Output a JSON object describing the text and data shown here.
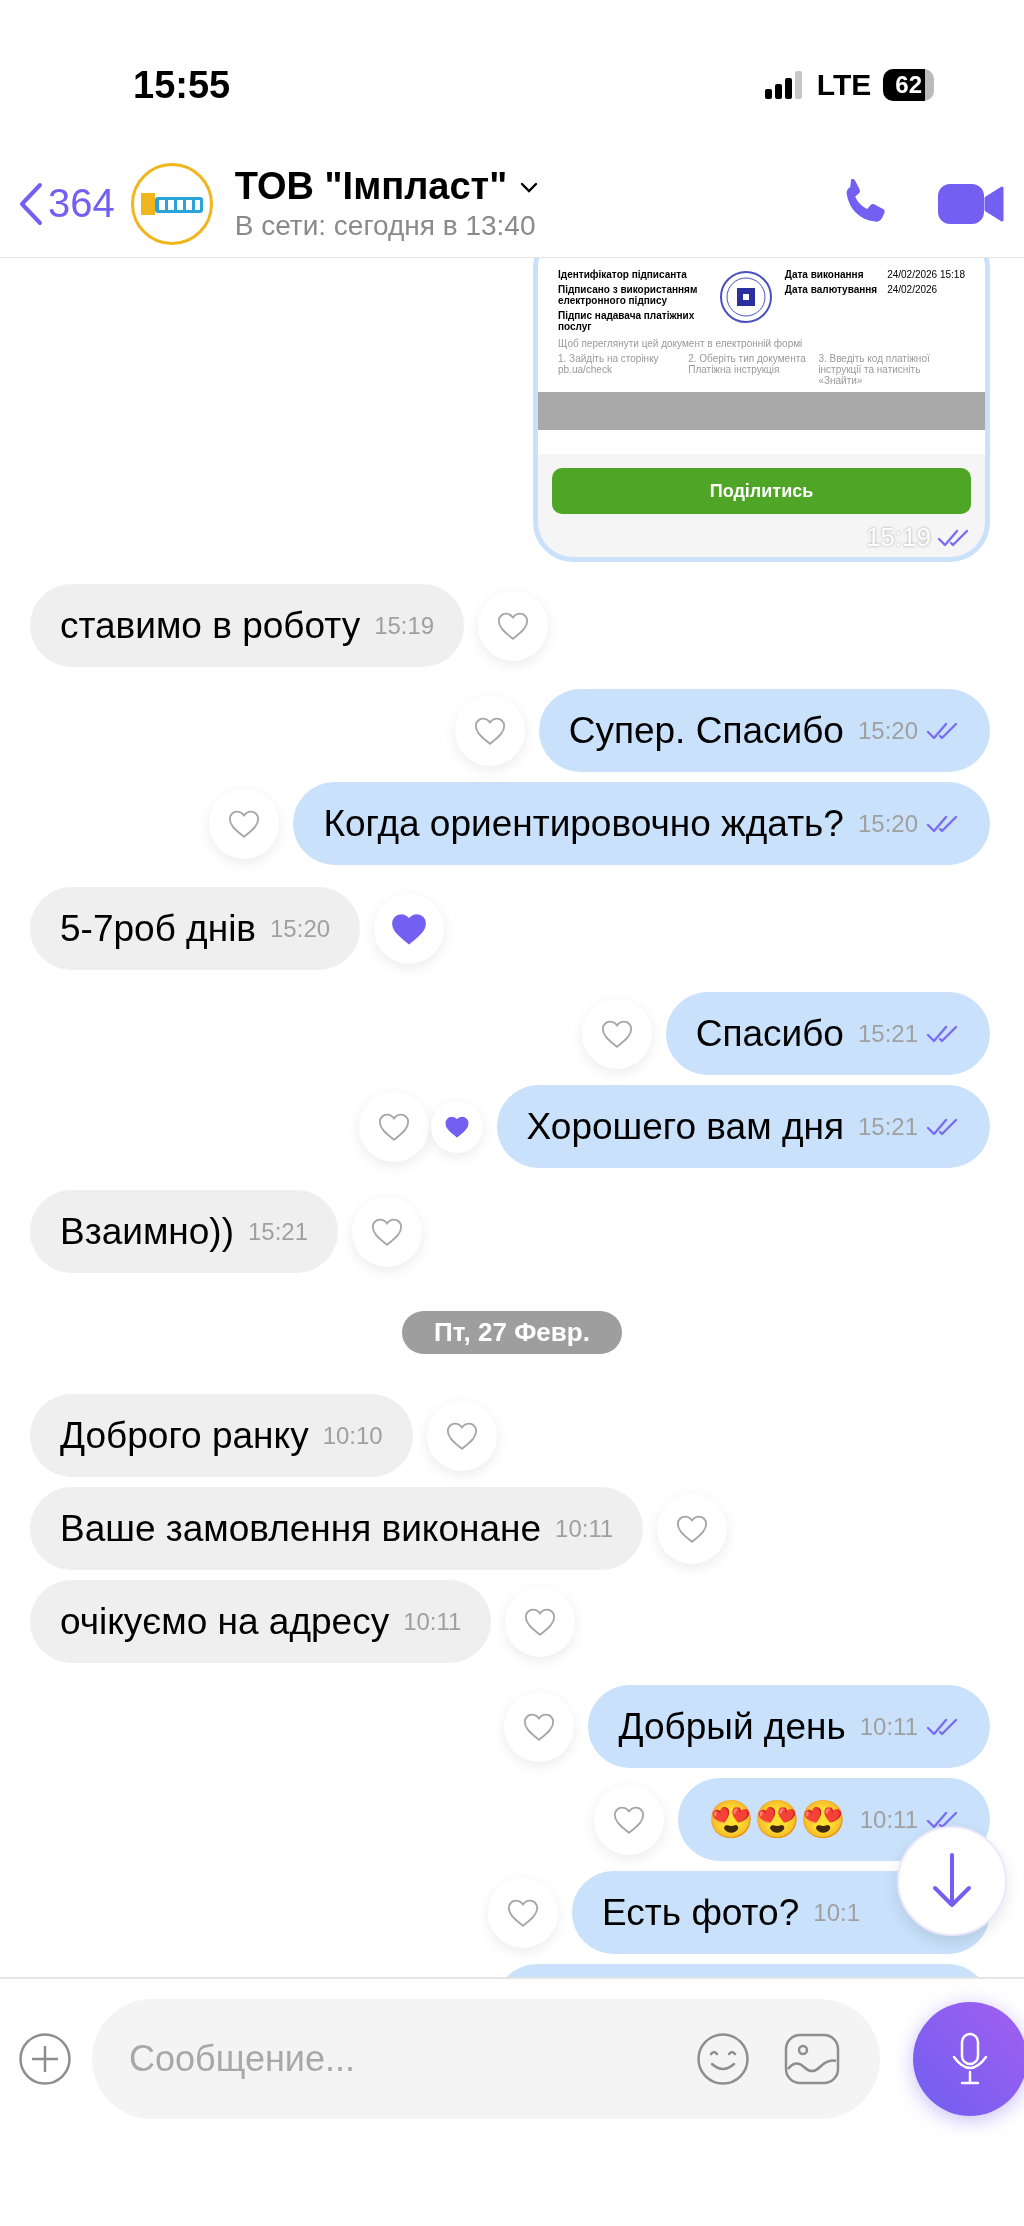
{
  "status_bar": {
    "time": "15:55",
    "network": "LTE",
    "battery": "62"
  },
  "header": {
    "back_count": "364",
    "title": "ТОВ \"Імпласт\"",
    "subtitle": "В сети: сегодня в 13:40"
  },
  "messages": [
    {
      "kind": "document",
      "outgoing": true,
      "time": "15:19",
      "ticks": true,
      "document": {
        "left_rows": [
          "Ідентифікатор підписанта",
          "Підписано з використанням електронного підпису",
          "Підпис надавача платіжних послуг"
        ],
        "right_rows": [
          {
            "label": "Дата виконання",
            "value": "24/02/2026 15:18"
          },
          {
            "label": "Дата валютування",
            "value": "24/02/2026"
          }
        ],
        "hint": "Щоб переглянути цей документ в електронній формі",
        "steps": [
          "1. Зайдіть на сторінку pb.ua/check",
          "2. Оберіть тип документа Платіжна інструкція",
          "3. Введіть код платіжної інструкції та натисніть «Знайти»"
        ]
      },
      "button": "Поділитись"
    },
    {
      "kind": "text",
      "outgoing": false,
      "text": "ставимо в роботу",
      "time": "15:19",
      "liked": false,
      "liked_by_other": false
    },
    {
      "kind": "text",
      "outgoing": true,
      "text": "Супер. Спасибо",
      "time": "15:20",
      "ticks": true,
      "liked": false,
      "liked_by_other": false
    },
    {
      "kind": "text",
      "outgoing": true,
      "text": "Когда ориентировочно ждать?",
      "time": "15:20",
      "ticks": true,
      "liked": false,
      "liked_by_other": false
    },
    {
      "kind": "text",
      "outgoing": false,
      "text": "5-7роб днів",
      "time": "15:20",
      "liked": true,
      "liked_by_other": false
    },
    {
      "kind": "text",
      "outgoing": true,
      "text": "Спасибо",
      "time": "15:21",
      "ticks": true,
      "liked": false,
      "liked_by_other": false
    },
    {
      "kind": "text",
      "outgoing": true,
      "text": "Хорошего вам дня",
      "time": "15:21",
      "ticks": true,
      "liked": false,
      "liked_by_other": true
    },
    {
      "kind": "text",
      "outgoing": false,
      "text": "Взаимно))",
      "time": "15:21",
      "liked": false,
      "liked_by_other": false
    },
    {
      "kind": "date",
      "text": "Пт, 27 Февр."
    },
    {
      "kind": "text",
      "outgoing": false,
      "text": "Доброго ранку",
      "time": "10:10",
      "liked": false,
      "liked_by_other": false
    },
    {
      "kind": "text",
      "outgoing": false,
      "text": "Ваше замовлення виконане",
      "time": "10:11",
      "liked": false,
      "liked_by_other": false
    },
    {
      "kind": "text",
      "outgoing": false,
      "text": "очікуємо на адресу",
      "time": "10:11",
      "liked": false,
      "liked_by_other": false
    },
    {
      "kind": "text",
      "outgoing": true,
      "text": "Добрый день",
      "time": "10:11",
      "ticks": true,
      "liked": false,
      "liked_by_other": false
    },
    {
      "kind": "text",
      "outgoing": true,
      "text": "😍😍😍",
      "time": "10:11",
      "ticks": true,
      "liked": false,
      "liked_by_other": false
    },
    {
      "kind": "text",
      "outgoing": true,
      "text": "Есть фото?",
      "time": "10:1",
      "ticks": false,
      "liked": false,
      "liked_by_other": false
    },
    {
      "kind": "partial",
      "outgoing": true
    }
  ],
  "composer": {
    "placeholder": "Сообщение..."
  }
}
